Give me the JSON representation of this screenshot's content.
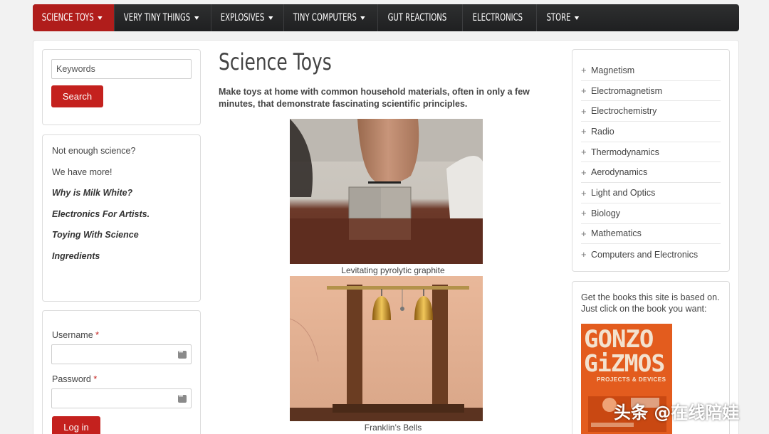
{
  "nav": {
    "items": [
      {
        "label": "SCIENCE TOYS",
        "dropdown": true,
        "active": true
      },
      {
        "label": "VERY TINY THINGS",
        "dropdown": true
      },
      {
        "label": "EXPLOSIVES",
        "dropdown": true
      },
      {
        "label": "TINY COMPUTERS",
        "dropdown": true
      },
      {
        "label": "GUT REACTIONS",
        "dropdown": false
      },
      {
        "label": "ELECTRONICS",
        "dropdown": false
      },
      {
        "label": "STORE",
        "dropdown": true
      }
    ]
  },
  "search": {
    "placeholder": "Keywords",
    "button": "Search"
  },
  "promo": {
    "lines": [
      "Not enough science?",
      "We have more!"
    ],
    "links": [
      "Why is Milk White?",
      "Electronics For Artists.",
      "Toying With Science",
      "Ingredients"
    ]
  },
  "login": {
    "username_label": "Username",
    "password_label": "Password",
    "required": "*",
    "button": "Log in"
  },
  "main": {
    "title": "Science Toys",
    "intro": "Make toys at home with common household materials, often in only a few minutes, that demonstrate fascinating scientific principles.",
    "figures": [
      {
        "caption": "Levitating pyrolytic graphite"
      },
      {
        "caption": "Franklin’s Bells"
      }
    ]
  },
  "categories": [
    "Magnetism",
    "Electromagnetism",
    "Electrochemistry",
    "Radio",
    "Thermodynamics",
    "Aerodynamics",
    "Light and Optics",
    "Biology",
    "Mathematics",
    "Computers and Electronics"
  ],
  "books": {
    "text": "Get the books this site is based on. Just click on the book you want:",
    "cover_title_1": "GONZO",
    "cover_title_2": "GiZMOS",
    "cover_subtitle": "PROJECTS & DEVICES"
  },
  "watermark": "头条 @在线陪娃",
  "colors": {
    "accent": "#c4211e",
    "nav_bg": "#262728"
  }
}
